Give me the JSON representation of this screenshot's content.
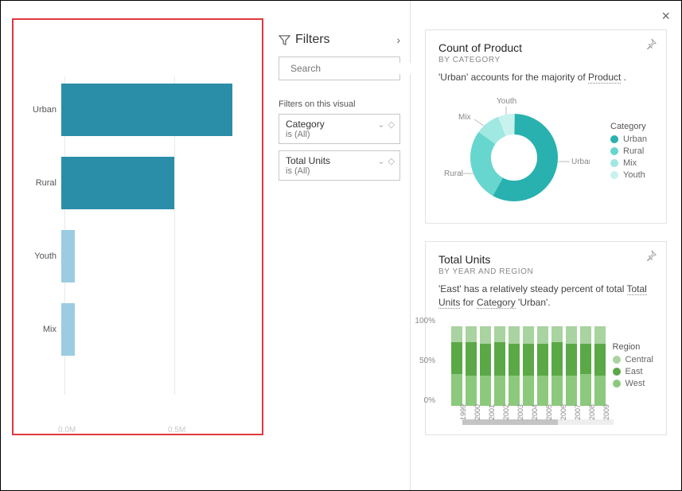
{
  "chart_data": [
    {
      "type": "bar",
      "orientation": "horizontal",
      "categories": [
        "Urban",
        "Rural",
        "Youth",
        "Mix"
      ],
      "values": [
        0.63,
        0.42,
        0.05,
        0.05
      ],
      "xlim": [
        0,
        0.7
      ],
      "x_ticks": [
        "0.0M",
        "0.5M"
      ],
      "colors": [
        "#2a8ea8",
        "#2a8ea8",
        "#9ccce1",
        "#9ccce1"
      ]
    },
    {
      "type": "pie",
      "title": "Count of Product",
      "subtitle": "BY CATEGORY",
      "series": [
        {
          "name": "Urban",
          "value": 58,
          "color": "#28b1af"
        },
        {
          "name": "Rural",
          "value": 27,
          "color": "#67d6cf"
        },
        {
          "name": "Mix",
          "value": 9,
          "color": "#a0e8e2"
        },
        {
          "name": "Youth",
          "value": 6,
          "color": "#c8f2ee"
        }
      ]
    },
    {
      "type": "stacked-bar-100",
      "title": "Total Units",
      "subtitle": "BY YEAR AND REGION",
      "categories": [
        "1999",
        "2000",
        "2001",
        "2002",
        "2003",
        "2004",
        "2005",
        "2006",
        "2007",
        "2008",
        "2009"
      ],
      "series": [
        {
          "name": "Central",
          "color": "#a9d3a0",
          "values": [
            20,
            20,
            22,
            20,
            22,
            22,
            22,
            20,
            22,
            22,
            22
          ]
        },
        {
          "name": "East",
          "color": "#5ba847",
          "values": [
            40,
            42,
            40,
            42,
            40,
            40,
            40,
            42,
            40,
            38,
            40
          ]
        },
        {
          "name": "West",
          "color": "#8cc97d",
          "values": [
            40,
            38,
            38,
            38,
            38,
            38,
            38,
            38,
            38,
            40,
            38
          ]
        }
      ],
      "ylim": [
        0,
        100
      ],
      "y_ticks": [
        "0%",
        "50%",
        "100%"
      ]
    }
  ],
  "bars": {
    "row0": {
      "label": "Urban",
      "width_pct": 88,
      "color": "#2a8ea8"
    },
    "row1": {
      "label": "Rural",
      "width_pct": 58,
      "color": "#2a8ea8"
    },
    "row2": {
      "label": "Youth",
      "width_pct": 7,
      "color": "#9ccce1"
    },
    "row3": {
      "label": "Mix",
      "width_pct": 7,
      "color": "#9ccce1"
    }
  },
  "bar_axis": {
    "tick0": "0.0M",
    "tick1": "0.5M"
  },
  "filters": {
    "title": "Filters",
    "search_placeholder": "Search",
    "section_label": "Filters on this visual",
    "f0": {
      "name": "Category",
      "value": "is (All)"
    },
    "f1": {
      "name": "Total Units",
      "value": "is (All)"
    }
  },
  "card_product": {
    "title": "Count of Product",
    "sub": "BY CATEGORY",
    "desc_pre": "'Urban' accounts for the majority of ",
    "desc_dotted": "Product",
    "desc_post": " .",
    "legend_title": "Category",
    "lg0": "Urban",
    "lg1": "Rural",
    "lg2": "Mix",
    "lg3": "Youth",
    "sl_urban": "Urban",
    "sl_rural": "Rural",
    "sl_mix": "Mix",
    "sl_youth": "Youth"
  },
  "card_units": {
    "title": "Total Units",
    "sub": "BY YEAR AND REGION",
    "desc_pre": "'East' has a relatively steady percent of total ",
    "desc_dot1": "Total Units",
    "desc_mid": " for ",
    "desc_dot2": "Category",
    "desc_post": " 'Urban'.",
    "legend_title": "Region",
    "lg0": "Central",
    "lg1": "East",
    "lg2": "West",
    "y0": "0%",
    "y50": "50%",
    "y100": "100%",
    "x": {
      "0": "1999",
      "1": "2000",
      "2": "2001",
      "3": "2002",
      "4": "2003",
      "5": "2004",
      "6": "2005",
      "7": "2006",
      "8": "2007",
      "9": "2008",
      "10": "2009"
    }
  }
}
